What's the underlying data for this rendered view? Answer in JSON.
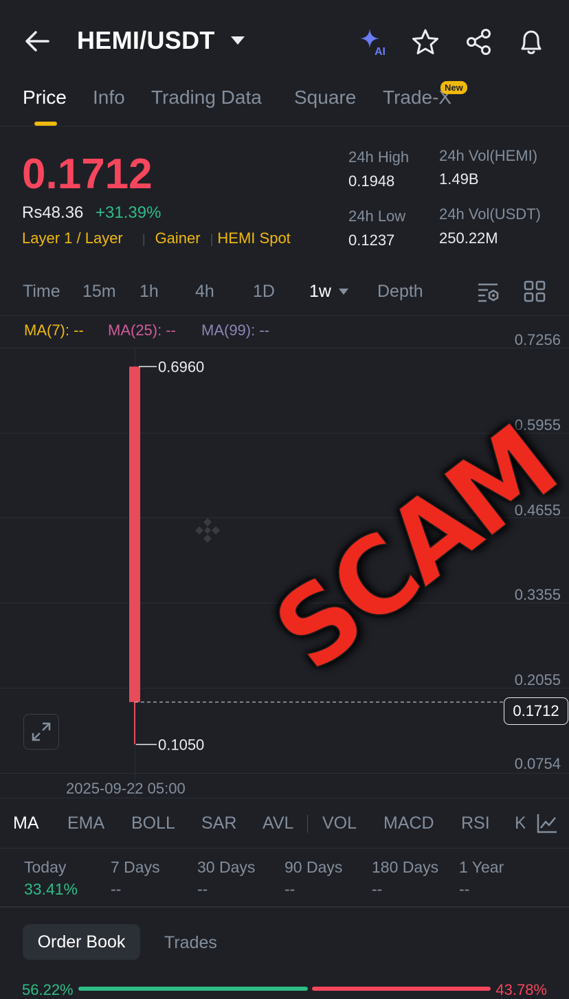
{
  "header": {
    "pair": "HEMI/USDT",
    "icons": [
      "back-arrow-icon",
      "caret-down-icon",
      "ai-sparkle-icon",
      "star-icon",
      "share-icon",
      "bell-icon"
    ]
  },
  "tabs": [
    {
      "label": "Price",
      "active": true
    },
    {
      "label": "Info"
    },
    {
      "label": "Trading Data"
    },
    {
      "label": "Square"
    },
    {
      "label": "Trade-X",
      "badge": "New"
    }
  ],
  "ticker": {
    "price": "0.1712",
    "fiat": "Rs48.36",
    "change": "+31.39%",
    "tags": [
      "Layer 1 / Layer",
      "Gainer",
      "HEMI Spot"
    ],
    "high_label": "24h High",
    "high": "0.1948",
    "low_label": "24h Low",
    "low": "0.1237",
    "vol_base_label": "24h Vol(HEMI)",
    "vol_base": "1.49B",
    "vol_quote_label": "24h Vol(USDT)",
    "vol_quote": "250.22M"
  },
  "intervals": [
    "Time",
    "15m",
    "1h",
    "4h",
    "1D",
    "1w",
    "Depth"
  ],
  "active_interval": "1w",
  "ma": {
    "ma7": "MA(7): --",
    "ma25": "MA(25): --",
    "ma99": "MA(99): --"
  },
  "chart_data": {
    "type": "candlestick",
    "y_ticks": [
      "0.7256",
      "0.5955",
      "0.4655",
      "0.3355",
      "0.2055",
      "0.0754"
    ],
    "ylim": [
      0.0754,
      0.7256
    ],
    "candles": [
      {
        "date": "2025-09-22 05:00",
        "open": 0.696,
        "high": 0.696,
        "low": 0.105,
        "close": 0.1712
      }
    ],
    "high_label": "0.6960",
    "low_label": "0.1050",
    "current_price": "0.1712",
    "x_label": "2025-09-22 05:00",
    "candle_color": "#e84b5a"
  },
  "overlay_text": "SCAM",
  "indicators": [
    "MA",
    "EMA",
    "BOLL",
    "SAR",
    "AVL",
    "VOL",
    "MACD",
    "RSI",
    "KD"
  ],
  "performance": [
    {
      "label": "Today",
      "value": "33.41%"
    },
    {
      "label": "7 Days",
      "value": "--"
    },
    {
      "label": "30 Days",
      "value": "--"
    },
    {
      "label": "90 Days",
      "value": "--"
    },
    {
      "label": "180 Days",
      "value": "--"
    },
    {
      "label": "1 Year",
      "value": "--"
    }
  ],
  "bottom_tabs": {
    "order_book": "Order Book",
    "trades": "Trades"
  },
  "depth_ratio": {
    "buy": "56.22%",
    "sell": "43.78%",
    "buy_fraction": 0.5622
  }
}
